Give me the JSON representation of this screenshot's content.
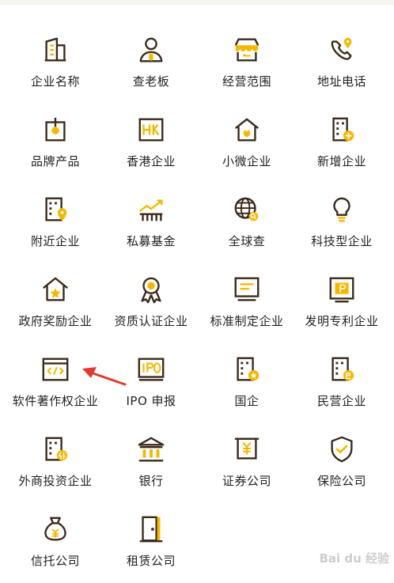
{
  "colors": {
    "dark": "#3a2a1a",
    "accent": "#f5b800",
    "arrow": "#e23b2e"
  },
  "items": [
    {
      "label": "企业名称",
      "icon": "building-icon"
    },
    {
      "label": "查老板",
      "icon": "boss-person-icon"
    },
    {
      "label": "经营范围",
      "icon": "store-icon"
    },
    {
      "label": "地址电话",
      "icon": "phone-location-icon"
    },
    {
      "label": "品牌产品",
      "icon": "brand-box-icon"
    },
    {
      "label": "香港企业",
      "icon": "hk-badge-icon"
    },
    {
      "label": "小微企业",
      "icon": "small-house-icon"
    },
    {
      "label": "新增企业",
      "icon": "new-building-icon"
    },
    {
      "label": "附近企业",
      "icon": "nearby-building-icon"
    },
    {
      "label": "私募基金",
      "icon": "trend-chart-icon"
    },
    {
      "label": "全球查",
      "icon": "globe-search-icon"
    },
    {
      "label": "科技型企业",
      "icon": "lightbulb-icon"
    },
    {
      "label": "政府奖励企业",
      "icon": "award-house-icon"
    },
    {
      "label": "资质认证企业",
      "icon": "medal-icon"
    },
    {
      "label": "标准制定企业",
      "icon": "monitor-doc-icon"
    },
    {
      "label": "发明专利企业",
      "icon": "patent-certificate-icon"
    },
    {
      "label": "软件著作权企业",
      "icon": "code-window-icon"
    },
    {
      "label": "IPO 申报",
      "icon": "ipo-icon"
    },
    {
      "label": "国企",
      "icon": "state-owned-building-icon"
    },
    {
      "label": "民营企业",
      "icon": "private-building-icon"
    },
    {
      "label": "外商投资企业",
      "icon": "foreign-building-icon"
    },
    {
      "label": "银行",
      "icon": "bank-icon"
    },
    {
      "label": "证券公司",
      "icon": "yen-scroll-icon"
    },
    {
      "label": "保险公司",
      "icon": "shield-check-icon"
    },
    {
      "label": "信托公司",
      "icon": "money-bag-icon"
    },
    {
      "label": "租赁公司",
      "icon": "door-icon"
    }
  ],
  "watermark": "Bai du 经验"
}
